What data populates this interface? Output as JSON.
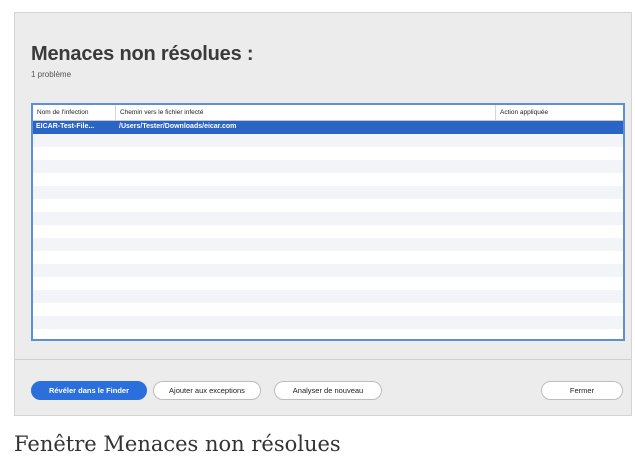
{
  "dialog": {
    "title": "Menaces non résolues :",
    "subtitle": "1 problème"
  },
  "table": {
    "columns": [
      "Nom de l'infection",
      "Chemin vers le fichier infecté",
      "Action appliquée"
    ],
    "rows": [
      {
        "name": "EICAR-Test-File...",
        "path": "/Users/Tester/Downloads/eicar.com",
        "action": "",
        "selected": true
      }
    ]
  },
  "buttons": {
    "reveal": "Révéler dans le Finder",
    "add_exceptions": "Ajouter aux exceptions",
    "rescan": "Analyser de nouveau",
    "close": "Fermer"
  },
  "caption": "Fenêtre Menaces non résolues",
  "colors": {
    "accent": "#2a6fdb",
    "selection": "#2a64c4",
    "table_border": "#5b8fd6"
  }
}
